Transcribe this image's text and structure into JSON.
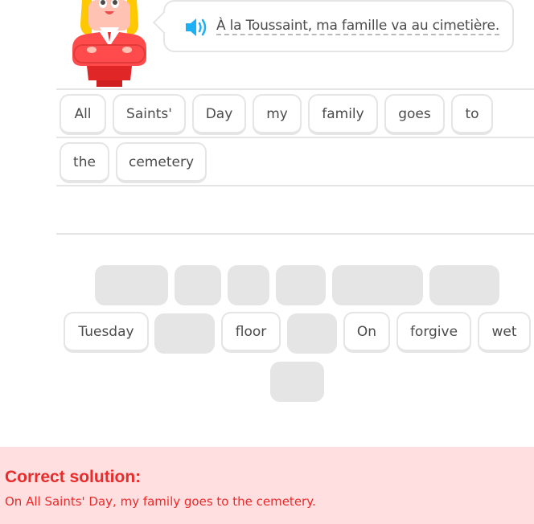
{
  "prompt": {
    "speaker_icon": "speaker-icon",
    "text": "À la Toussaint, ma famille va au cimetière."
  },
  "answer": {
    "words": [
      "All",
      "Saints'",
      "Day",
      "my",
      "family",
      "goes",
      "to",
      "the",
      "cemetery"
    ]
  },
  "word_bank": {
    "words": [
      "Tuesday",
      "floor",
      "On",
      "forgive",
      "wet"
    ]
  },
  "result": {
    "title": "Correct solution:",
    "solution": "On All Saints' Day, my family goes to the cemetery."
  },
  "colors": {
    "banner_bg": "#ffdfe0",
    "error_red": "#ea2b2b",
    "speaker_blue": "#1cb0f6",
    "border_gray": "#e5e5e5"
  }
}
